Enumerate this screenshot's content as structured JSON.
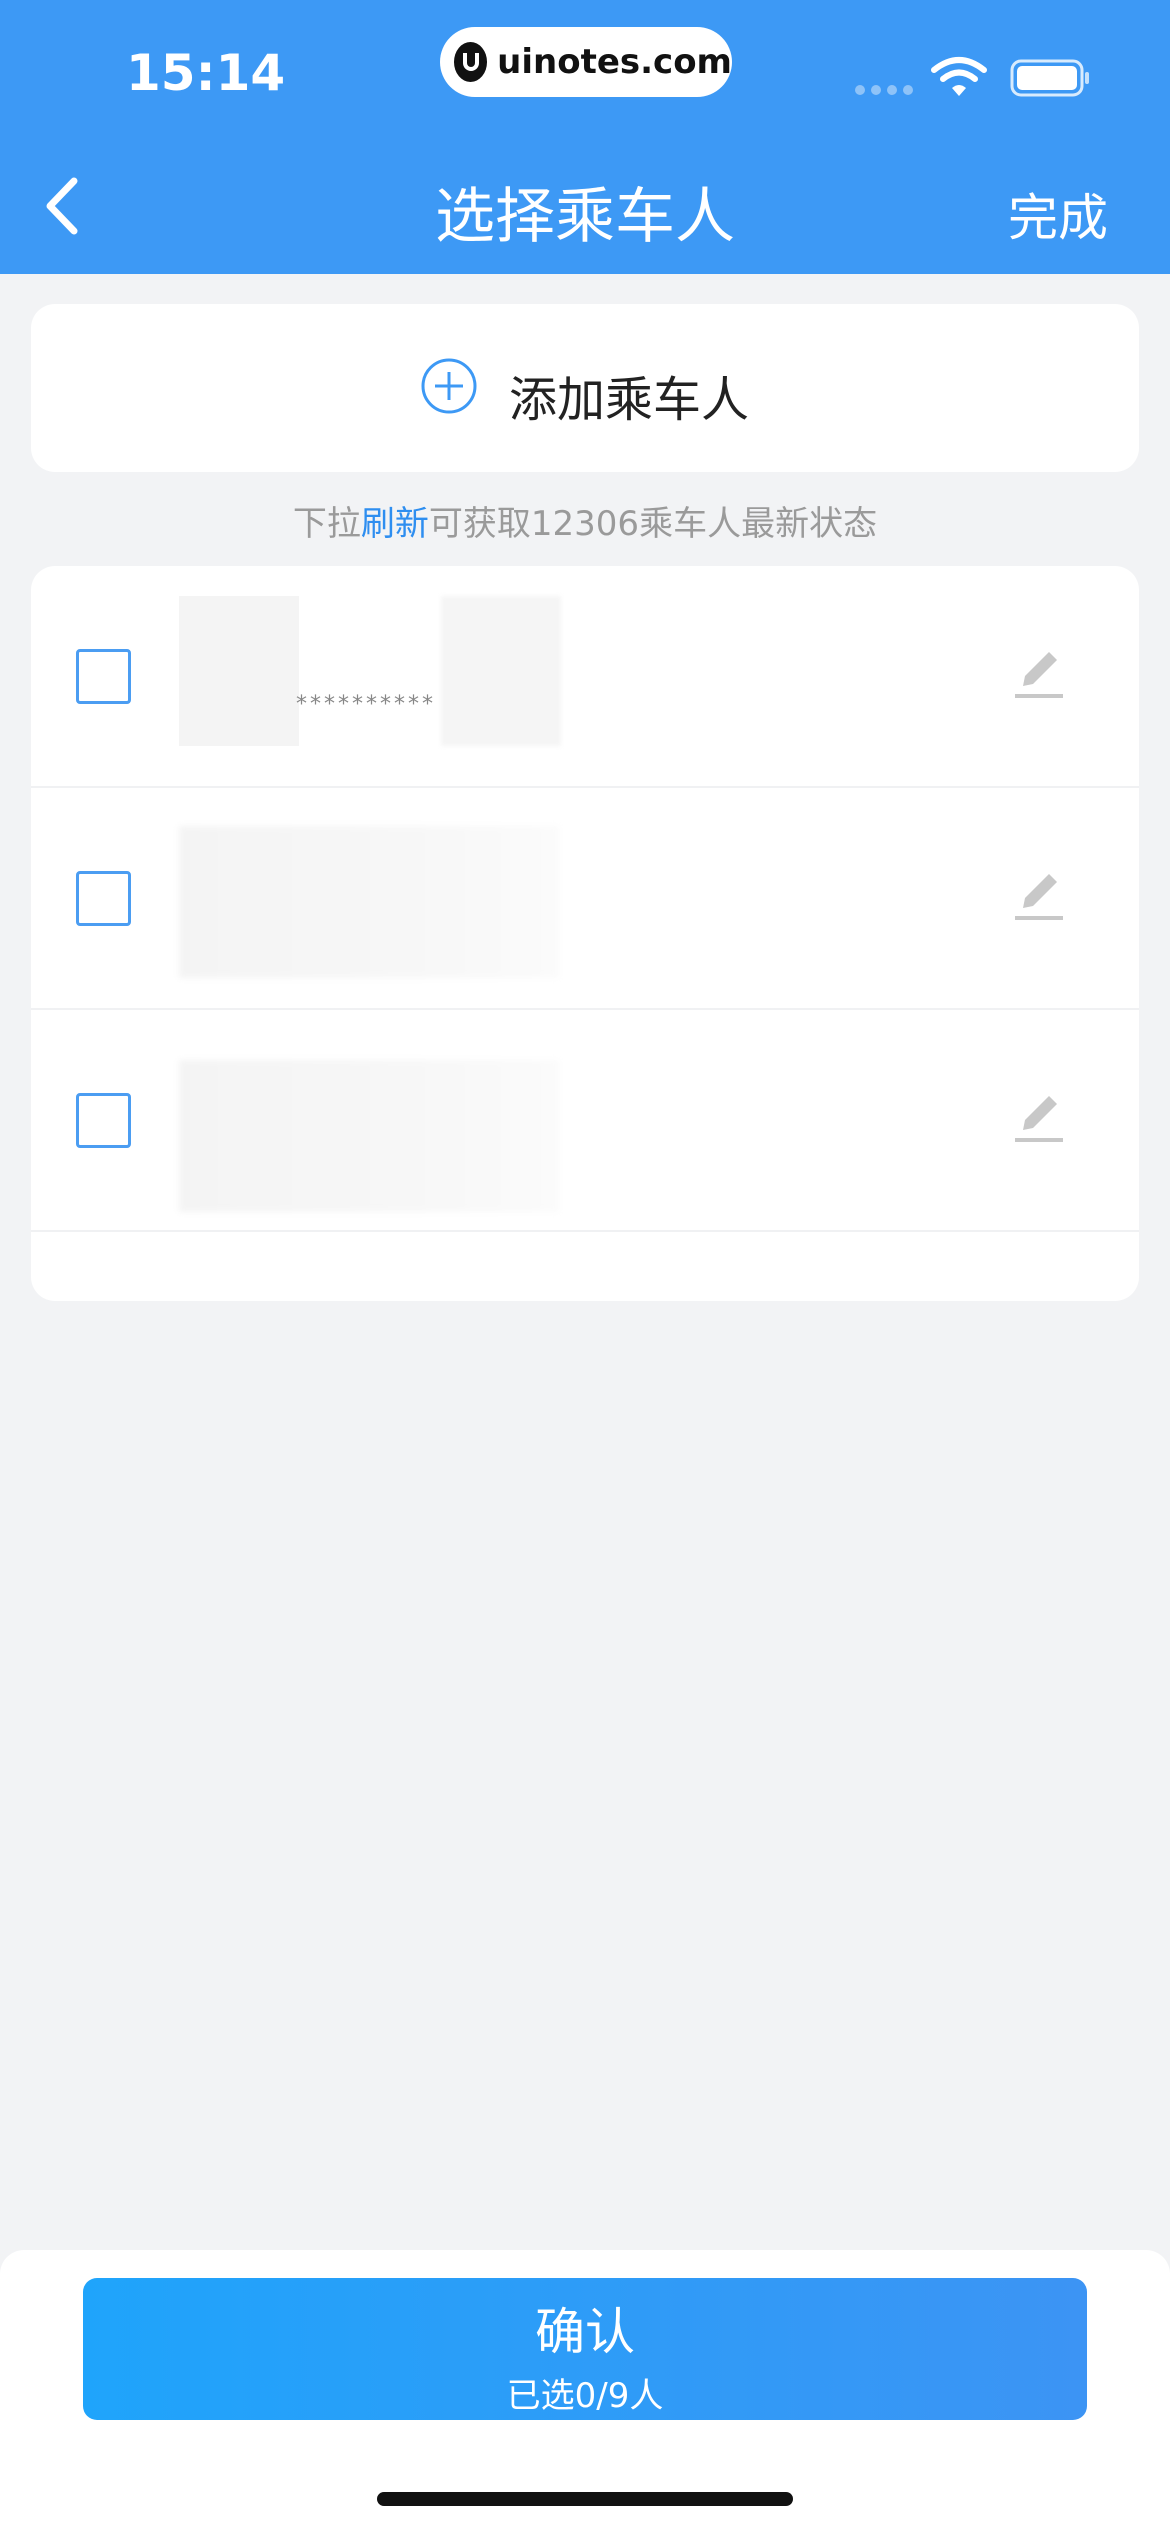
{
  "status_bar": {
    "time": "15:14",
    "watermark": "uinotes.com"
  },
  "header": {
    "title": "选择乘车人",
    "done_label": "完成"
  },
  "add_passenger": {
    "label": "添加乘车人"
  },
  "hint": {
    "prefix": "下拉",
    "link": "刷新",
    "suffix": "可获取12306乘车人最新状态"
  },
  "passengers": [
    {
      "masked_id": "**********",
      "checked": false
    },
    {
      "masked_id": "",
      "checked": false
    },
    {
      "masked_id": "",
      "checked": false
    }
  ],
  "confirm": {
    "label": "确认",
    "count_text": "已选0/9人"
  },
  "colors": {
    "header": "#3d99f5",
    "accent": "#2e8ef0",
    "background": "#f2f3f5"
  }
}
